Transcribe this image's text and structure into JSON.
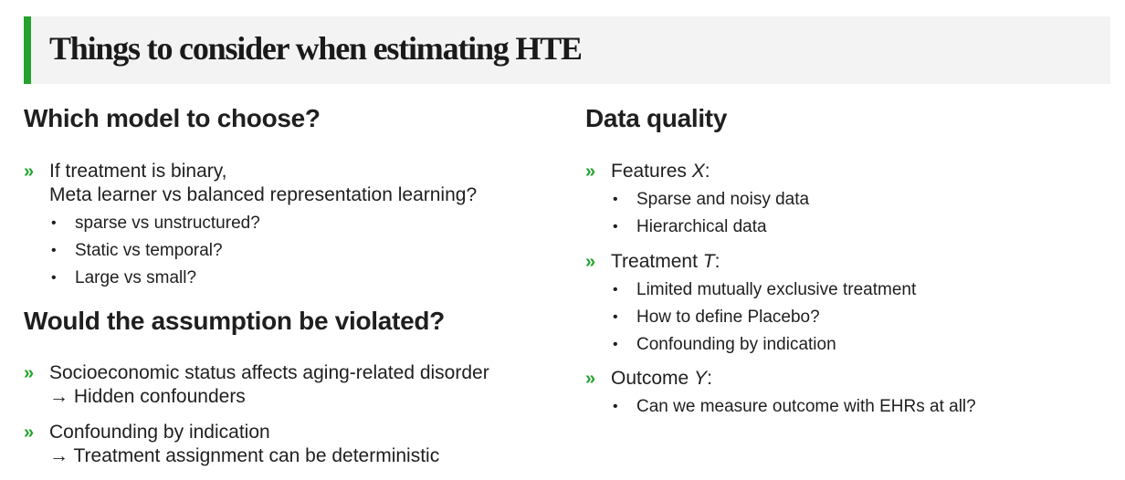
{
  "title": "Things to consider when estimating HTE",
  "colors": {
    "accent": "#22a32d",
    "title_bg": "#f3f3f3",
    "text": "#1f1f1f"
  },
  "left": {
    "section1": {
      "heading": "Which model to choose?",
      "bullet1": {
        "line1": "If treatment is binary,",
        "line2": "Meta learner vs balanced representation learning?",
        "subs": [
          "sparse vs unstructured?",
          "Static vs temporal?",
          "Large vs small?"
        ]
      }
    },
    "section2": {
      "heading": "Would the assumption be violated?",
      "bullet1": {
        "line1": "Socioeconomic status affects aging-related disorder",
        "line2": "Hidden confounders"
      },
      "bullet2": {
        "line1": "Confounding by indication",
        "line2": "Treatment assignment can be deterministic"
      }
    }
  },
  "right": {
    "heading": "Data quality",
    "features": {
      "label": "Features ",
      "var": "X",
      "subs": [
        "Sparse and noisy data",
        "Hierarchical data"
      ]
    },
    "treatment": {
      "label": "Treatment ",
      "var": "T",
      "subs": [
        "Limited mutually exclusive treatment",
        "How to define Placebo?",
        "Confounding by indication"
      ]
    },
    "outcome": {
      "label": "Outcome ",
      "var": "Y",
      "subs": [
        "Can we measure outcome with EHRs at all?"
      ]
    }
  },
  "symbols": {
    "bullet": "»",
    "sub_bullet": "•",
    "arrow": "→",
    "colon": ":"
  }
}
